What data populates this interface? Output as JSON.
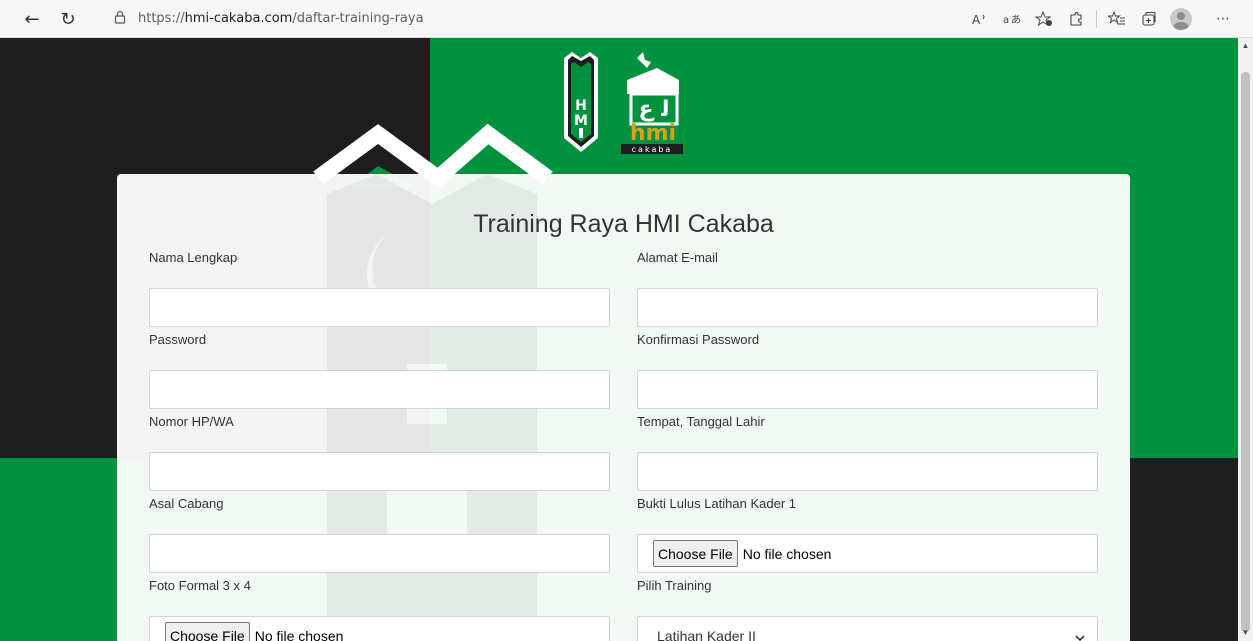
{
  "browser": {
    "url_prefix": "https://",
    "url_host": "hmi-cakaba.com",
    "url_path": "/daftar-training-raya",
    "icons": [
      "back-icon",
      "reload-icon",
      "lock-icon",
      "read-aloud-icon",
      "translate-icon",
      "favorite-add-icon",
      "extensions-icon",
      "favorites-icon",
      "collections-icon",
      "profile-icon",
      "more-icon"
    ]
  },
  "colors": {
    "brand_green": "#00923f",
    "dark": "#1e1e1e",
    "logo_gold": "#d6a21e"
  },
  "logo": {
    "hmi_letters": "HMI",
    "cakaba_word": "hmi",
    "cakaba_sub": "cakaba"
  },
  "form": {
    "title": "Training Raya HMI Cakaba",
    "fields": [
      {
        "label": "Nama Lengkap"
      },
      {
        "label": "Alamat E-mail"
      },
      {
        "label": "Password"
      },
      {
        "label": "Konfirmasi Password"
      },
      {
        "label": "Nomor HP/WA"
      },
      {
        "label": "Tempat, Tanggal Lahir"
      },
      {
        "label": "Asal Cabang"
      },
      {
        "label": "Bukti Lulus Latihan Kader 1",
        "button": "Choose File",
        "status": "No file chosen"
      },
      {
        "label": "Foto Formal 3 x 4",
        "button": "Choose File",
        "status": "No file chosen"
      },
      {
        "label": "Pilih Training",
        "selected": "Latihan Kader II"
      }
    ]
  }
}
